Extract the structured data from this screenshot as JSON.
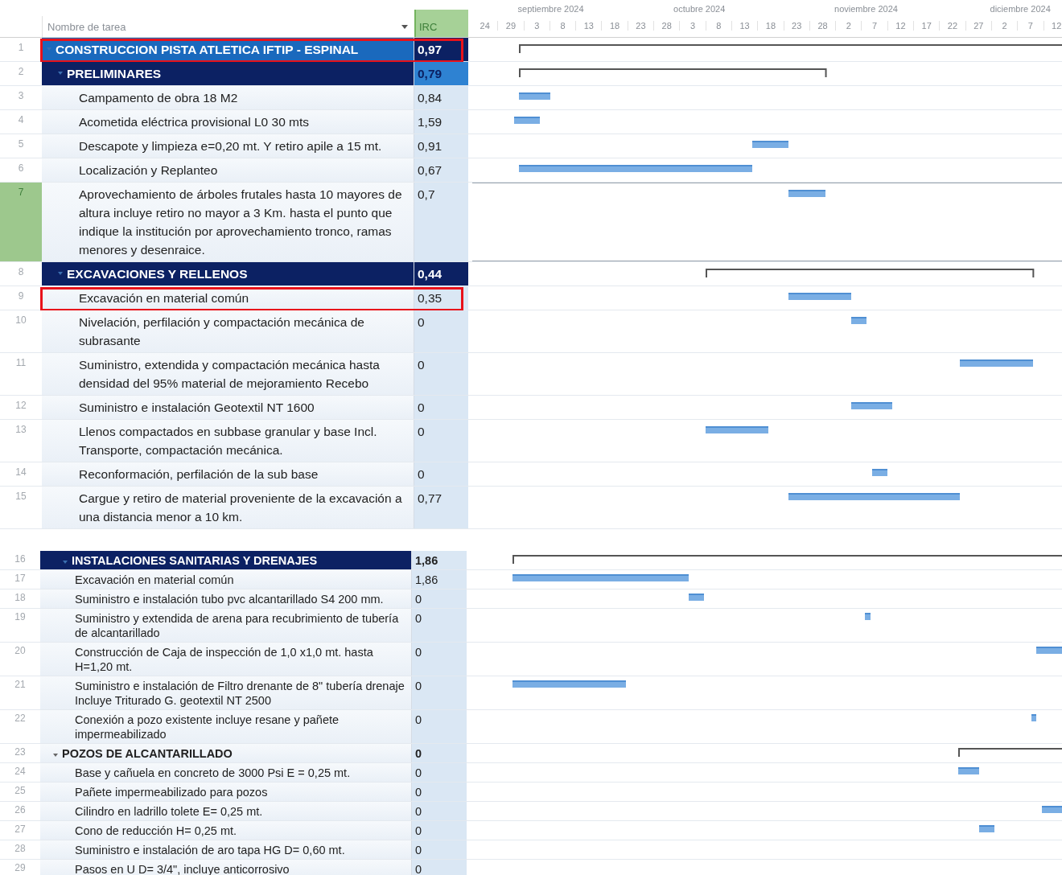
{
  "timeline": {
    "months": [
      "septiembre 2024",
      "octubre 2024",
      "noviembre 2024",
      "diciembre 2024"
    ],
    "days": [
      "24",
      "29",
      "3",
      "8",
      "13",
      "18",
      "23",
      "28",
      "3",
      "8",
      "13",
      "18",
      "23",
      "28",
      "2",
      "7",
      "12",
      "17",
      "22",
      "27",
      "2",
      "7",
      "12"
    ]
  },
  "panels": [
    {
      "kind": "main",
      "columns": {
        "name": "Nombre de tarea",
        "irc": "IRC"
      },
      "rows": [
        {
          "id": "1",
          "name": "CONSTRUCCION PISTA ATLETICA IFTIP - ESPINAL",
          "irc": "0,97",
          "kind": "project",
          "selected": false,
          "outlined": true,
          "irc_selected": false
        },
        {
          "id": "2",
          "name": "PRELIMINARES",
          "irc": "0,79",
          "kind": "phase",
          "selected": false,
          "outlined": false,
          "irc_selected": true
        },
        {
          "id": "3",
          "name": "Campamento de obra 18 M2",
          "irc": "0,84",
          "kind": "task",
          "selected": false,
          "outlined": false,
          "irc_selected": false
        },
        {
          "id": "4",
          "name": "Acometida eléctrica provisional L0 30 mts",
          "irc": "1,59",
          "kind": "task",
          "selected": false,
          "outlined": false,
          "irc_selected": false
        },
        {
          "id": "5",
          "name": "Descapote y limpieza e=0,20 mt. Y retiro apile a 15 mt.",
          "irc": "0,91",
          "kind": "task",
          "selected": false,
          "outlined": false,
          "irc_selected": false
        },
        {
          "id": "6",
          "name": "Localización y Replanteo",
          "irc": "0,67",
          "kind": "task",
          "selected": false,
          "outlined": false,
          "irc_selected": false
        },
        {
          "id": "7",
          "name": "Aprovechamiento de árboles frutales hasta 10 mayores de altura incluye retiro no mayor a 3 Km. hasta el punto que indique la institución por aprovechamiento tronco, ramas menores y desenraice.",
          "irc": "0,7",
          "kind": "task",
          "selected": true,
          "outlined": false,
          "irc_selected": false
        },
        {
          "id": "8",
          "name": "EXCAVACIONES Y RELLENOS",
          "irc": "0,44",
          "kind": "phase",
          "selected": false,
          "outlined": false,
          "irc_selected": false
        },
        {
          "id": "9",
          "name": "Excavación en material común",
          "irc": "0,35",
          "kind": "task",
          "selected": false,
          "outlined": true,
          "irc_selected": false
        },
        {
          "id": "10",
          "name": "Nivelación, perfilación y compactación mecánica de subrasante",
          "irc": "0",
          "kind": "task",
          "selected": false,
          "outlined": false,
          "irc_selected": false
        },
        {
          "id": "11",
          "name": "Suministro, extendida y compactación mecánica hasta densidad del 95% material de mejoramiento Recebo",
          "irc": "0",
          "kind": "task",
          "selected": false,
          "outlined": false,
          "irc_selected": false
        },
        {
          "id": "12",
          "name": "Suministro e instalación Geotextil NT 1600",
          "irc": "0",
          "kind": "task",
          "selected": false,
          "outlined": false,
          "irc_selected": false
        },
        {
          "id": "13",
          "name": "Llenos compactados en subbase granular y base Incl. Transporte, compactación mecánica.",
          "irc": "0",
          "kind": "task",
          "selected": false,
          "outlined": false,
          "irc_selected": false
        },
        {
          "id": "14",
          "name": "Reconformación, perfilación de la sub base",
          "irc": "0",
          "kind": "task",
          "selected": false,
          "outlined": false,
          "irc_selected": false
        },
        {
          "id": "15",
          "name": "Cargue y retiro de material proveniente de la excavación a una distancia menor a 10 km.",
          "irc": "0,77",
          "kind": "task",
          "selected": false,
          "outlined": false,
          "irc_selected": false
        }
      ]
    },
    {
      "kind": "continued",
      "rows": [
        {
          "id": "16",
          "name": "INSTALACIONES SANITARIAS Y DRENAJES",
          "irc": "1,86",
          "kind": "phase",
          "selected": false,
          "outlined": false,
          "irc_selected": false
        },
        {
          "id": "17",
          "name": "Excavación en material común",
          "irc": "1,86",
          "kind": "task",
          "selected": false,
          "outlined": false,
          "irc_selected": false
        },
        {
          "id": "18",
          "name": "Suministro e instalación tubo pvc alcantarillado S4 200 mm.",
          "irc": "0",
          "kind": "task",
          "selected": false,
          "outlined": false,
          "irc_selected": false
        },
        {
          "id": "19",
          "name": "Suministro y extendida de arena para recubrimiento de tubería de alcantarillado",
          "irc": "0",
          "kind": "task",
          "selected": false,
          "outlined": false,
          "irc_selected": false
        },
        {
          "id": "20",
          "name": "Construcción de Caja de inspección de 1,0 x1,0 mt. hasta H=1,20 mt.",
          "irc": "0",
          "kind": "task",
          "selected": false,
          "outlined": false,
          "irc_selected": false
        },
        {
          "id": "21",
          "name": "Suministro e instalación de Filtro drenante de 8\" tubería drenaje Incluye Triturado G. geotextil NT 2500",
          "irc": "0",
          "kind": "task",
          "selected": false,
          "outlined": false,
          "irc_selected": false
        },
        {
          "id": "22",
          "name": "Conexión a pozo existente incluye resane y pañete impermeabilizado",
          "irc": "0",
          "kind": "task",
          "selected": false,
          "outlined": false,
          "irc_selected": false
        },
        {
          "id": "23",
          "name": "POZOS DE ALCANTARILLADO",
          "irc": "0",
          "kind": "subphase",
          "selected": false,
          "outlined": false,
          "irc_selected": false
        },
        {
          "id": "24",
          "name": "Base y cañuela en concreto de 3000 Psi E = 0,25 mt.",
          "irc": "0",
          "kind": "task",
          "selected": false,
          "outlined": false,
          "irc_selected": false
        },
        {
          "id": "25",
          "name": "Pañete impermeabilizado para pozos",
          "irc": "0",
          "kind": "task",
          "selected": false,
          "outlined": false,
          "irc_selected": false
        },
        {
          "id": "26",
          "name": "Cilindro en ladrillo tolete E= 0,25 mt.",
          "irc": "0",
          "kind": "task",
          "selected": false,
          "outlined": false,
          "irc_selected": false
        },
        {
          "id": "27",
          "name": "Cono de reducción H= 0,25 mt.",
          "irc": "0",
          "kind": "task",
          "selected": false,
          "outlined": false,
          "irc_selected": false
        },
        {
          "id": "28",
          "name": "Suministro e instalación de aro tapa HG D= 0,60 mt.",
          "irc": "0",
          "kind": "task",
          "selected": false,
          "outlined": false,
          "irc_selected": false
        },
        {
          "id": "29",
          "name": "Pasos en U D= 3/4\", incluye anticorrosivo",
          "irc": "0",
          "kind": "task",
          "selected": false,
          "outlined": false,
          "irc_selected": false
        }
      ]
    }
  ]
}
